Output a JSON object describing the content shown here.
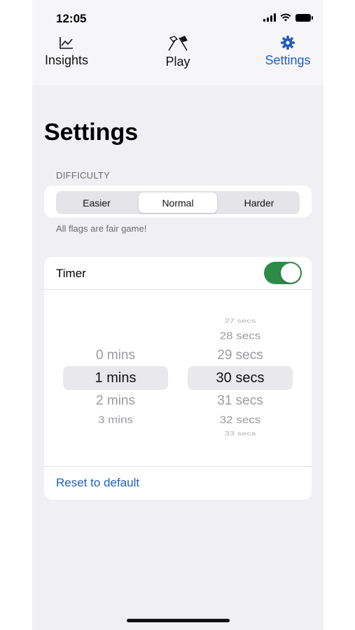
{
  "status_bar": {
    "time": "12:05"
  },
  "tabs": [
    {
      "label": "Insights",
      "icon": "chart-line-icon",
      "active": false
    },
    {
      "label": "Play",
      "icon": "crossed-flags-icon",
      "active": false
    },
    {
      "label": "Settings",
      "icon": "gear-icon",
      "active": true
    }
  ],
  "colors": {
    "accent": "#1f5fbf",
    "toggle_on": "#2e8b47",
    "background": "#efeff4"
  },
  "page": {
    "title": "Settings"
  },
  "difficulty": {
    "section_label": "DIFFICULTY",
    "options": [
      "Easier",
      "Normal",
      "Harder"
    ],
    "selected": "Normal",
    "footnote": "All flags are fair game!"
  },
  "timer": {
    "label": "Timer",
    "enabled": true,
    "minutes": {
      "options": [
        "0 mins",
        "1 mins",
        "2 mins",
        "3 mins"
      ],
      "selected": "1 mins"
    },
    "seconds": {
      "options": [
        "27 secs",
        "28 secs",
        "29 secs",
        "30 secs",
        "31 secs",
        "32 secs",
        "33 secs"
      ],
      "selected": "30 secs"
    },
    "reset_label": "Reset to default"
  }
}
